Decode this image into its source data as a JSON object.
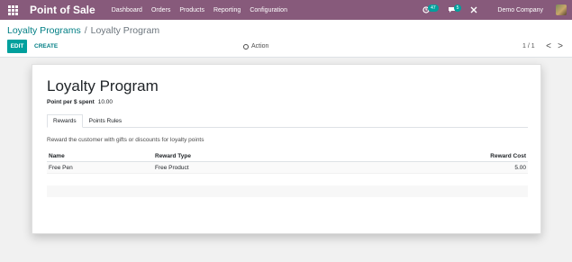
{
  "topbar": {
    "app_title": "Point of Sale",
    "menu": [
      "Dashboard",
      "Orders",
      "Products",
      "Reporting",
      "Configuration"
    ],
    "activity_count": "47",
    "messages_count": "5",
    "company": "Demo Company"
  },
  "breadcrumb": {
    "parent": "Loyalty Programs",
    "separator": "/",
    "current": "Loyalty Program"
  },
  "buttons": {
    "edit": "EDIT",
    "create": "CREATE",
    "action": "Action"
  },
  "pager": {
    "value": "1 / 1",
    "prev": "<",
    "next": ">"
  },
  "form": {
    "title": "Loyalty Program",
    "points_label": "Point per $ spent",
    "points_value": "10.00",
    "tabs": [
      "Rewards",
      "Points Rules"
    ],
    "rewards_description": "Reward the customer with gifts or discounts for loyalty points"
  },
  "table": {
    "headers": [
      "Name",
      "Reward Type",
      "Reward Cost"
    ],
    "rows": [
      [
        "Free Pen",
        "Free Product",
        "5.00"
      ]
    ]
  },
  "colors": {
    "brand": "#875a7b",
    "primary": "#00a09d",
    "link": "#017e84"
  }
}
